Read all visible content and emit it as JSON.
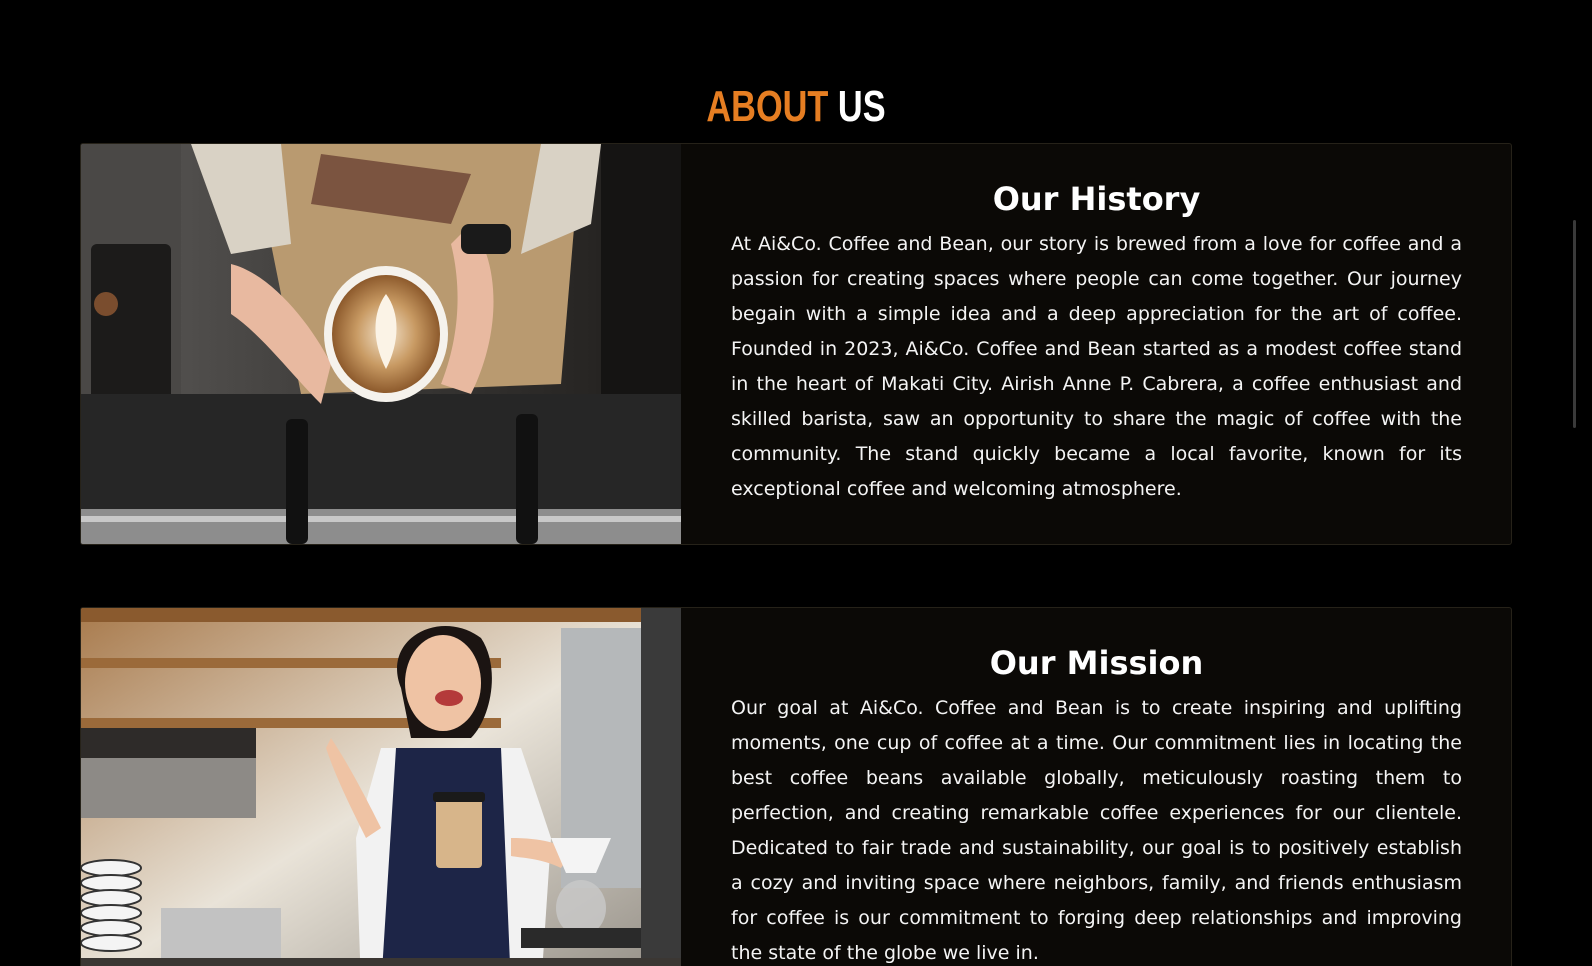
{
  "heading": {
    "accent": "ABOUT",
    "rest": "US"
  },
  "history": {
    "title": "Our History",
    "body": "At Ai&Co. Coffee and Bean, our story is brewed from a love for coffee and a passion for creating spaces where people can come together. Our journey begain with a simple idea and a deep appreciation for the art of coffee. Founded in 2023, Ai&Co. Coffee and Bean started as a modest coffee stand in the heart of Makati City. Airish Anne P. Cabrera, a coffee enthusiast and skilled barista, saw an opportunity to share the magic of coffee with the community. The stand quickly became a local favorite, known for its exceptional coffee and welcoming atmosphere."
  },
  "mission": {
    "title": "Our Mission",
    "body": "Our goal at Ai&Co. Coffee and Bean is to create inspiring and uplifting moments, one cup of coffee at a time. Our commitment lies in locating the best coffee beans available globally, meticulously roasting them to perfection, and creating remarkable coffee experiences for our clientele. Dedicated to fair trade and sustainability, our goal is to positively establish a cozy and inviting space where neighbors, family, and friends enthusiasm for coffee is our commitment to forging deep relationships and improving the state of the globe we live in."
  },
  "colors": {
    "accent": "#e67e22",
    "background": "#000000",
    "card": "#0b0906"
  }
}
